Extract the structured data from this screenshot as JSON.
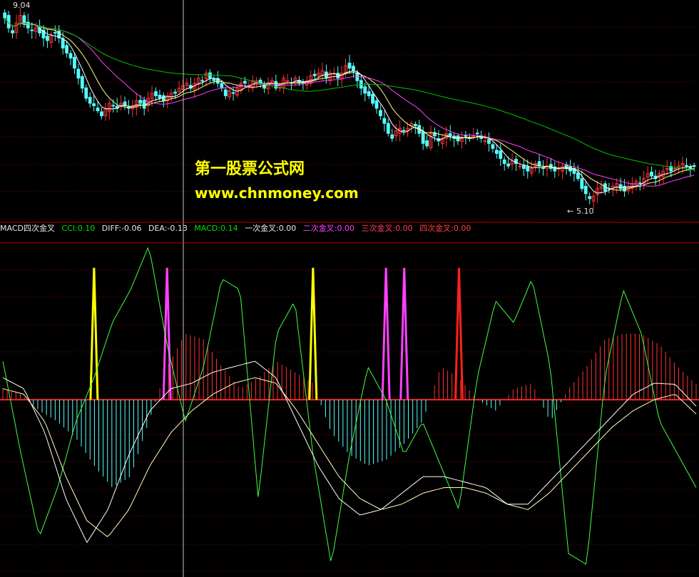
{
  "indicator_bar": {
    "name": "MACD四次金叉",
    "items": [
      {
        "label": "CCI:0.10",
        "color": "#00e000"
      },
      {
        "label": "DIFF:-0.06",
        "color": "#e8e8e8"
      },
      {
        "label": "DEA:-0.13",
        "color": "#e8e8e8"
      },
      {
        "label": "MACD:0.14",
        "color": "#00e000"
      },
      {
        "label": "一次金叉:0.00",
        "color": "#e8e8e8"
      },
      {
        "label": "二次金叉:0.00",
        "color": "#ff40ff"
      },
      {
        "label": "三次金叉:0.00",
        "color": "#ff4060"
      },
      {
        "label": "四次金叉:0.00",
        "color": "#ff4040"
      }
    ]
  },
  "watermark": {
    "title": "第一股票公式网",
    "url": "www.chnmoney.com"
  },
  "colors": {
    "up": "#ff3232",
    "down": "#54ffff",
    "ma5": "#ffffff",
    "ma10": "#ffff88",
    "ma20": "#ff40ff",
    "ma60": "#00c000",
    "cci": "#40ff40",
    "diff": "#ffffff",
    "dea": "#ffffc0",
    "macd_pos": "#ff3232",
    "macd_neg": "#54ffff",
    "signal1": "#ffff00",
    "signal2": "#ff40ff",
    "signal3": "#ff40ff",
    "signal4": "#ff2020",
    "grid": "#8b0000"
  },
  "chart_data": [
    {
      "type": "candlestick",
      "title": "",
      "price_labels": {
        "high": "9.04",
        "low": "5.10"
      },
      "high_marker": 9.04,
      "low_marker": 5.1,
      "ylim": [
        4.9,
        9.1
      ],
      "grid": true,
      "moving_averages": [
        "ma5",
        "ma10",
        "ma20",
        "ma60"
      ],
      "close": [
        8.8,
        8.6,
        8.5,
        8.7,
        8.85,
        8.7,
        8.6,
        8.55,
        8.6,
        8.5,
        8.4,
        8.35,
        8.45,
        8.5,
        8.4,
        8.2,
        8.1,
        8.0,
        7.8,
        7.6,
        7.4,
        7.2,
        7.1,
        7.05,
        6.95,
        6.85,
        7.0,
        7.1,
        7.05,
        7.0,
        7.1,
        7.05,
        7.0,
        7.05,
        7.15,
        7.1,
        7.0,
        7.2,
        7.3,
        7.25,
        7.2,
        7.15,
        7.25,
        7.3,
        7.3,
        7.4,
        7.45,
        7.5,
        7.4,
        7.5,
        7.6,
        7.55,
        7.7,
        7.6,
        7.55,
        7.5,
        7.4,
        7.25,
        7.35,
        7.3,
        7.4,
        7.5,
        7.5,
        7.45,
        7.55,
        7.55,
        7.5,
        7.4,
        7.5,
        7.55,
        7.4,
        7.45,
        7.6,
        7.55,
        7.5,
        7.6,
        7.5,
        7.5,
        7.55,
        7.65,
        7.65,
        7.7,
        7.75,
        7.6,
        7.7,
        7.7,
        7.6,
        7.7,
        7.85,
        7.8,
        7.75,
        7.55,
        7.4,
        7.3,
        7.25,
        7.1,
        7.0,
        6.85,
        6.7,
        6.5,
        6.4,
        6.55,
        6.6,
        6.55,
        6.6,
        6.7,
        6.65,
        6.5,
        6.3,
        6.25,
        6.5,
        6.45,
        6.35,
        6.4,
        6.5,
        6.45,
        6.4,
        6.35,
        6.4,
        6.45,
        6.4,
        6.45,
        6.5,
        6.4,
        6.35,
        6.3,
        6.2,
        6.1,
        6.0,
        5.9,
        5.85,
        5.95,
        5.9,
        5.85,
        5.8,
        5.75,
        5.8,
        5.9,
        5.85,
        5.8,
        5.85,
        5.8,
        5.75,
        5.8,
        5.85,
        5.8,
        5.75,
        5.7,
        5.6,
        5.4,
        5.3,
        5.2,
        5.25,
        5.4,
        5.45,
        5.35,
        5.4,
        5.45,
        5.5,
        5.4,
        5.35,
        5.45,
        5.5,
        5.55,
        5.5,
        5.6,
        5.7,
        5.65,
        5.6,
        5.7,
        5.75,
        5.8,
        5.75,
        5.8,
        5.85,
        5.9,
        5.85,
        5.8,
        5.85
      ]
    },
    {
      "type": "line+bar",
      "title": "MACD四次金叉",
      "ylim": [
        -1.6,
        1.4
      ],
      "zero_line": 0,
      "grid": true,
      "series": [
        {
          "name": "CCI",
          "values": [
            0.35,
            -0.5,
            -1.25,
            -0.8,
            -0.2,
            0.2,
            0.7,
            1.0,
            1.4,
            0.5,
            -0.2,
            0.3,
            1.1,
            1.0,
            -0.9,
            0.6,
            0.9,
            -0.5,
            -1.5,
            -0.5,
            0.3,
            0.0,
            -0.5,
            -0.2,
            -0.6,
            -1.0,
            0.2,
            0.9,
            0.7,
            1.1,
            0.3,
            -1.4,
            -1.5,
            0.2,
            1.0,
            0.6,
            -0.2,
            -0.5,
            -0.8
          ]
        },
        {
          "name": "DIFF",
          "values": [
            0.2,
            0.1,
            -0.3,
            -0.9,
            -1.3,
            -1.0,
            -0.5,
            -0.1,
            0.1,
            0.15,
            0.25,
            0.3,
            0.35,
            0.2,
            -0.2,
            -0.6,
            -0.9,
            -1.05,
            -1.0,
            -0.85,
            -0.7,
            -0.7,
            -0.75,
            -0.8,
            -0.95,
            -0.95,
            -0.75,
            -0.55,
            -0.35,
            -0.15,
            0.05,
            0.15,
            0.14,
            -0.06
          ]
        },
        {
          "name": "DEA",
          "values": [
            0.1,
            0.05,
            -0.2,
            -0.7,
            -1.1,
            -1.25,
            -1.0,
            -0.6,
            -0.3,
            -0.1,
            0.05,
            0.15,
            0.2,
            0.15,
            -0.1,
            -0.4,
            -0.7,
            -0.9,
            -1.0,
            -0.95,
            -0.85,
            -0.8,
            -0.8,
            -0.85,
            -0.95,
            -1.0,
            -0.85,
            -0.65,
            -0.45,
            -0.25,
            -0.1,
            0.0,
            0.05,
            -0.13
          ]
        },
        {
          "name": "MACD",
          "values": [
            0.1,
            0.05,
            -0.1,
            -0.2,
            -0.35,
            -0.6,
            -0.8,
            -0.7,
            -0.2,
            0.3,
            0.6,
            0.55,
            0.3,
            0.1,
            0.2,
            0.35,
            0.25,
            0.15,
            -0.3,
            -0.5,
            -0.6,
            -0.55,
            -0.4,
            -0.2,
            0.3,
            0.2,
            0.0,
            -0.1,
            0.1,
            0.15,
            -0.2,
            0.1,
            0.3,
            0.55,
            0.6,
            0.6,
            0.5,
            0.3,
            0.14
          ]
        }
      ],
      "signals": [
        {
          "name": "一次金叉",
          "bar_index": 5,
          "value": 1.0
        },
        {
          "name": "二次金叉",
          "bar_index": 9,
          "value": 1.0
        },
        {
          "name": "一次金叉",
          "bar_index": 17,
          "value": 1.0
        },
        {
          "name": "二次金叉",
          "bar_index": 21,
          "value": 1.0
        },
        {
          "name": "三次金叉",
          "bar_index": 22,
          "value": 1.0
        },
        {
          "name": "四次金叉",
          "bar_index": 25,
          "value": 1.0
        }
      ]
    }
  ]
}
